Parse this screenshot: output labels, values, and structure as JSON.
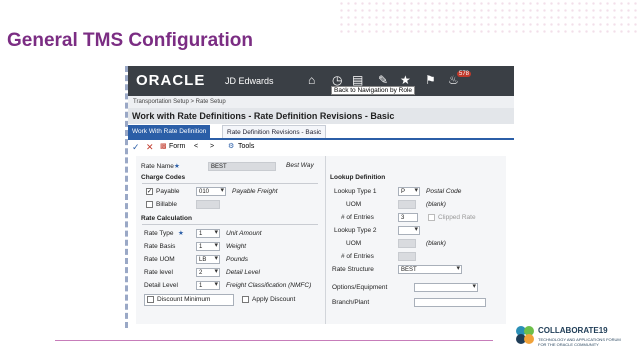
{
  "slide": {
    "title": "General TMS Configuration"
  },
  "header": {
    "brand": "ORACLE",
    "product": "JD Edwards",
    "tooltip": "Back to Navigation by Role",
    "notification_count": "578"
  },
  "breadcrumb": "Transportation Setup > Rate Setup",
  "form_title": "Work with Rate Definitions - Rate Definition Revisions - Basic",
  "tabs": [
    {
      "label": "Work With Rate Definition"
    },
    {
      "label": "Rate Definition Revisions - Basic"
    }
  ],
  "toolbar": {
    "form_label": "Form",
    "tools_label": "Tools"
  },
  "rate_name": {
    "label": "Rate Name",
    "value": "BEST",
    "description": "Best Way"
  },
  "charge_codes": {
    "heading": "Charge Codes",
    "payable_label": "Payable",
    "payable_checked": true,
    "payable_code": "010",
    "payable_desc": "Payable Freight",
    "billable_label": "Billable",
    "billable_checked": false
  },
  "rate_calculation": {
    "heading": "Rate Calculation",
    "rows": [
      {
        "label": "Rate Type",
        "value": "1",
        "desc": "Unit Amount"
      },
      {
        "label": "Rate Basis",
        "value": "1",
        "desc": "Weight"
      },
      {
        "label": "Rate UOM",
        "value": "LB",
        "desc": "Pounds"
      },
      {
        "label": "Rate level",
        "value": "2",
        "desc": "Detail Level"
      },
      {
        "label": "Detail Level",
        "value": "1",
        "desc": "Freight Classification (NMFC)"
      }
    ],
    "discount_minimum_label": "Discount Minimum",
    "apply_discount_label": "Apply Discount"
  },
  "lookup_definition": {
    "heading": "Lookup Definition",
    "lookup_type_1_label": "Lookup Type 1",
    "lookup_type_1_value": "P",
    "lookup_type_1_desc": "Postal Code",
    "uom_label": "UOM",
    "uom_1_desc": "(blank)",
    "entries_label": "# of Entries",
    "entries_1_value": "3",
    "clipped_rate_label": "Clipped Rate",
    "lookup_type_2_label": "Lookup Type 2",
    "uom_2_desc": "(blank)",
    "rate_structure_label": "Rate Structure",
    "rate_structure_value": "BEST",
    "options_equipment_label": "Options/Equipment",
    "branch_plant_label": "Branch/Plant"
  },
  "footer": {
    "brand": "COLLABORATE19",
    "tagline": "TECHNOLOGY AND APPLICATIONS FORUM FOR THE ORACLE COMMUNITY"
  },
  "colors": {
    "title": "#7b2d83",
    "header_bg": "#3a3f45",
    "tab_active": "#2b5ea7",
    "rule": "#c77dba"
  }
}
